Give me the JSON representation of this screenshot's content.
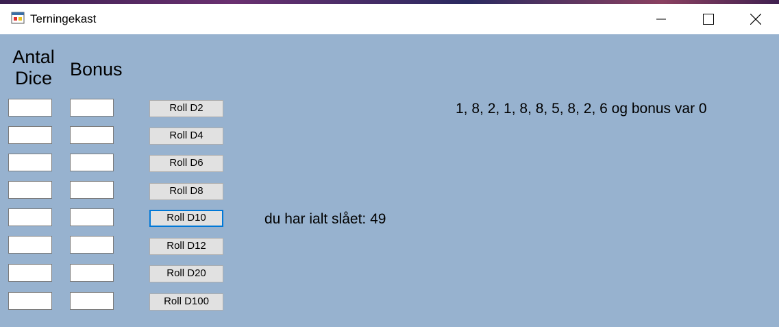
{
  "window": {
    "title": "Terningekast"
  },
  "headers": {
    "count_line1": "Antal",
    "count_line2": "Dice",
    "bonus": "Bonus"
  },
  "rows": [
    {
      "count": "",
      "bonus": "",
      "button": "Roll D2"
    },
    {
      "count": "",
      "bonus": "",
      "button": "Roll D4"
    },
    {
      "count": "",
      "bonus": "",
      "button": "Roll D6"
    },
    {
      "count": "",
      "bonus": "",
      "button": "Roll D8"
    },
    {
      "count": "",
      "bonus": "",
      "button": "Roll D10"
    },
    {
      "count": "",
      "bonus": "",
      "button": "Roll D12"
    },
    {
      "count": "",
      "bonus": "",
      "button": "Roll D20"
    },
    {
      "count": "",
      "bonus": "",
      "button": "Roll D100"
    }
  ],
  "focused_button": "Roll D10",
  "output": {
    "results": "1, 8, 2, 1, 8, 8, 5, 8, 2, 6 og bonus var 0",
    "total": "du har ialt slået: 49"
  },
  "icons": {
    "app": "app-window-icon",
    "minimize": "minimize-icon",
    "maximize": "maximize-icon",
    "close": "close-icon"
  },
  "colors": {
    "client_background": "#97b2cf",
    "button_face": "#e1e1e1",
    "focus_border": "#0078d7"
  }
}
